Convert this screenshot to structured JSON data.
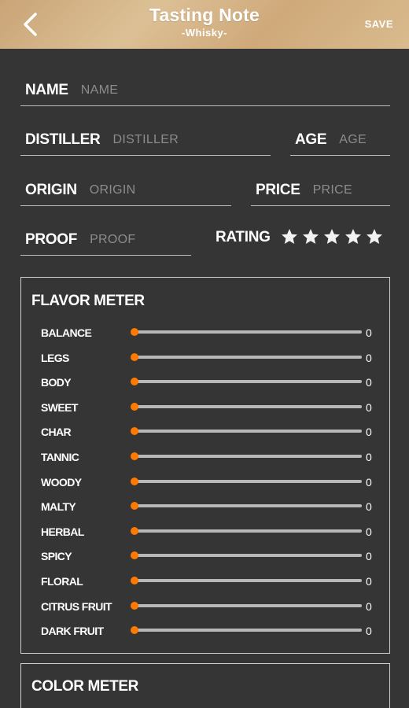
{
  "header": {
    "title": "Tasting Note",
    "subtitle": "-Whisky-",
    "save_label": "SAVE"
  },
  "form": {
    "name": {
      "label": "NAME",
      "placeholder": "NAME",
      "value": ""
    },
    "distiller": {
      "label": "DISTILLER",
      "placeholder": "DISTILLER",
      "value": ""
    },
    "age": {
      "label": "AGE",
      "placeholder": "AGE",
      "value": ""
    },
    "origin": {
      "label": "ORIGIN",
      "placeholder": "ORIGIN",
      "value": ""
    },
    "price": {
      "label": "PRICE",
      "placeholder": "PRICE",
      "value": ""
    },
    "proof": {
      "label": "PROOF",
      "placeholder": "PROOF",
      "value": ""
    },
    "rating": {
      "label": "RATING",
      "value": 0,
      "max": 5,
      "star_icon": "star-icon"
    }
  },
  "flavor_meter": {
    "title": "FLAVOR METER",
    "max": 10,
    "items": [
      {
        "label": "BALANCE",
        "value": "0"
      },
      {
        "label": "LEGS",
        "value": "0"
      },
      {
        "label": "BODY",
        "value": "0"
      },
      {
        "label": "SWEET",
        "value": "0"
      },
      {
        "label": "CHAR",
        "value": "0"
      },
      {
        "label": "TANNIC",
        "value": "0"
      },
      {
        "label": "WOODY",
        "value": "0"
      },
      {
        "label": "MALTY",
        "value": "0"
      },
      {
        "label": "HERBAL",
        "value": "0"
      },
      {
        "label": "SPICY",
        "value": "0"
      },
      {
        "label": "FLORAL",
        "value": "0"
      },
      {
        "label": "CITRUS FRUIT",
        "value": "0"
      },
      {
        "label": "DARK FRUIT",
        "value": "0"
      }
    ]
  },
  "color_meter": {
    "title": "COLOR METER"
  },
  "colors": {
    "header_bg": "#d2b186",
    "page_bg": "#353535",
    "accent": "#ff7a00",
    "track": "#b8b8b8"
  }
}
